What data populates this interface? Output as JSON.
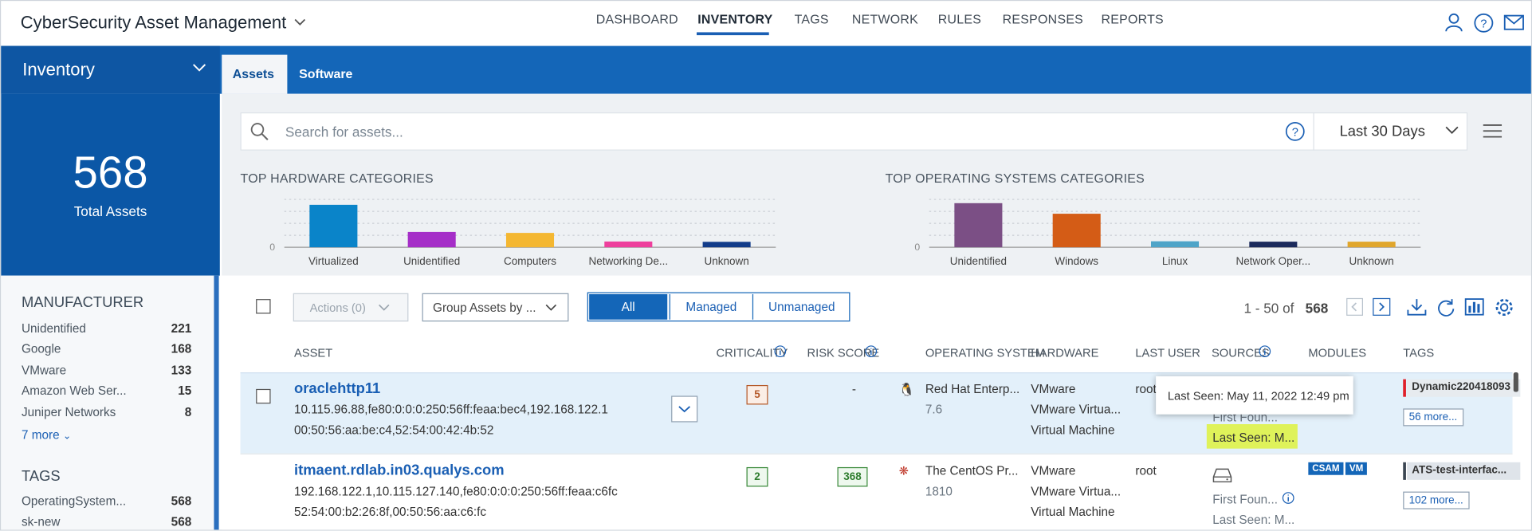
{
  "app": {
    "title": "CyberSecurity Asset Management"
  },
  "nav": [
    "DASHBOARD",
    "INVENTORY",
    "TAGS",
    "NETWORK",
    "RULES",
    "RESPONSES",
    "REPORTS"
  ],
  "module_dropdown": "Inventory",
  "tabs": [
    "Assets",
    "Software"
  ],
  "summary": {
    "total": "568",
    "label": "Total Assets"
  },
  "search": {
    "placeholder": "Search for assets...",
    "range": "Last 30 Days"
  },
  "facets": {
    "manufacturer": {
      "title": "MANUFACTURER",
      "items": [
        {
          "label": "Unidentified",
          "count": "221"
        },
        {
          "label": "Google",
          "count": "168"
        },
        {
          "label": "VMware",
          "count": "133"
        },
        {
          "label": "Amazon Web Ser...",
          "count": "15"
        },
        {
          "label": "Juniper Networks",
          "count": "8"
        }
      ],
      "more": "7 more"
    },
    "tags": {
      "title": "TAGS",
      "items": [
        {
          "label": "OperatingSystem...",
          "count": "568"
        },
        {
          "label": "sk-new",
          "count": "568"
        }
      ]
    }
  },
  "chart_data": [
    {
      "type": "bar",
      "title": "TOP HARDWARE CATEGORIES",
      "categories": [
        "Virtualized",
        "Unidentified",
        "Computers",
        "Networking De...",
        "Unknown"
      ],
      "values": [
        133,
        48,
        45,
        18,
        17
      ],
      "colors": [
        "#0a84c9",
        "#a52ec8",
        "#f4b731",
        "#ee3f9d",
        "#123c8a"
      ],
      "ylim": [
        0,
        150
      ],
      "tick_label": "0",
      "grid": true
    },
    {
      "type": "bar",
      "title": "TOP OPERATING SYSTEMS CATEGORIES",
      "categories": [
        "Unidentified",
        "Windows",
        "Linux",
        "Network Oper...",
        "Unknown"
      ],
      "values": [
        221,
        168,
        30,
        28,
        28
      ],
      "colors": [
        "#7b4f85",
        "#d45c16",
        "#4ea4c8",
        "#1b2a5c",
        "#e0a62c"
      ],
      "ylim": [
        0,
        240
      ],
      "tick_label": "0",
      "grid": true
    }
  ],
  "toolbar": {
    "actions": "Actions (0)",
    "group_by": "Group Assets by ...",
    "filters": [
      "All",
      "Managed",
      "Unmanaged"
    ],
    "pagination": "1 - 50 of",
    "total": "568"
  },
  "columns": [
    "ASSET",
    "CRITICALITY",
    "RISK SCORE",
    "OPERATING SYSTEM",
    "HARDWARE",
    "LAST USER",
    "SOURCES",
    "MODULES",
    "TAGS"
  ],
  "rows": [
    {
      "name": "oraclehttp11",
      "ips": "10.115.96.88,fe80:0:0:0:250:56ff:feaa:bec4,192.168.122.1",
      "macs": "00:50:56:aa:be:c4,52:54:00:42:4b:52",
      "criticality": "5",
      "risk": "-",
      "os": "Red Hat Enterp...",
      "os_ver": "7.6",
      "hw": [
        "VMware",
        "VMware Virtua...",
        "Virtual Machine"
      ],
      "user": "root",
      "first_found": "First Foun...",
      "last_seen": "Last Seen: M...",
      "modules": [],
      "tag": "Dynamic220418093",
      "more": "56 more..."
    },
    {
      "name": "itmaent.rdlab.in03.qualys.com",
      "ips": "192.168.122.1,10.115.127.140,fe80:0:0:0:250:56ff:feaa:c6fc",
      "macs": "52:54:00:b2:26:8f,00:50:56:aa:c6:fc",
      "criticality": "2",
      "risk": "368",
      "os": "The CentOS Pr...",
      "os_ver": "1810",
      "hw": [
        "VMware",
        "VMware Virtua...",
        "Virtual Machine"
      ],
      "user": "root",
      "first_found": "First Foun...",
      "last_seen": "Last Seen: M...",
      "modules": [
        "CSAM",
        "VM"
      ],
      "tag": "ATS-test-interfac...",
      "more": "102 more..."
    }
  ],
  "tooltip": "Last Seen: May 11, 2022 12:49 pm"
}
